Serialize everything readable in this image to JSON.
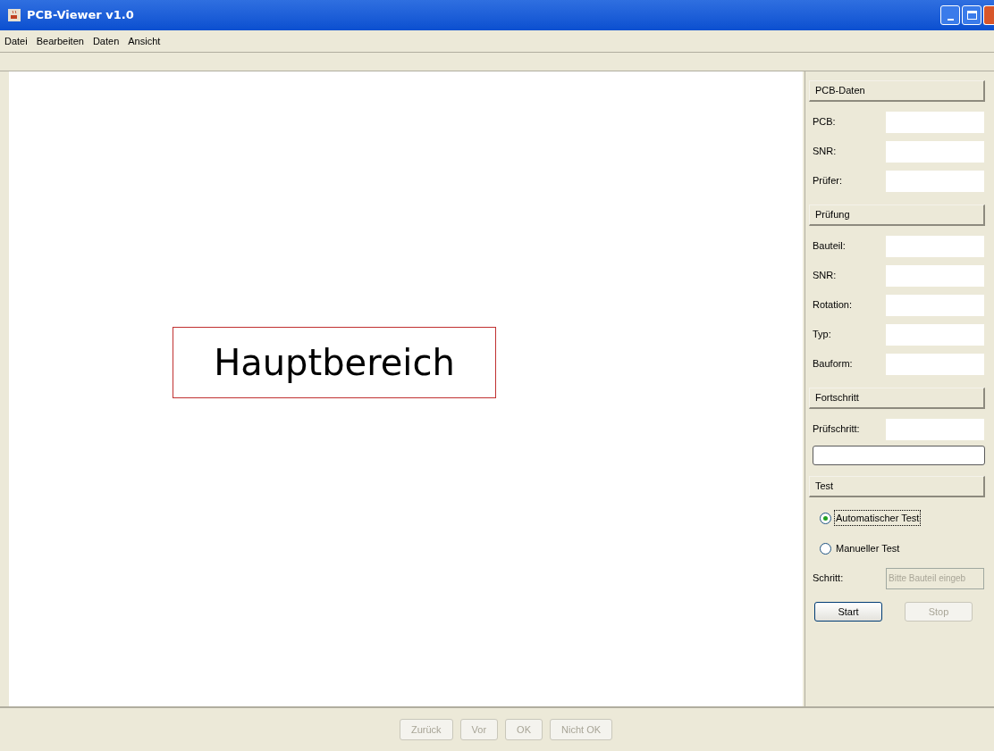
{
  "window": {
    "title": "PCB-Viewer v1.0"
  },
  "menu": [
    "Datei",
    "Bearbeiten",
    "Daten",
    "Ansicht"
  ],
  "main_area": {
    "label": "Hauptbereich"
  },
  "sections": [
    {
      "title": "PCB-Daten",
      "rows": [
        {
          "kind": "field",
          "label": "PCB:"
        },
        {
          "kind": "field",
          "label": "SNR:"
        },
        {
          "kind": "field",
          "label": "Prüfer:"
        }
      ]
    },
    {
      "title": "Prüfung",
      "rows": [
        {
          "kind": "field",
          "label": "Bauteil:"
        },
        {
          "kind": "field",
          "label": "SNR:"
        },
        {
          "kind": "field",
          "label": "Rotation:"
        },
        {
          "kind": "field",
          "label": "Typ:"
        },
        {
          "kind": "field",
          "label": "Bauform:"
        }
      ]
    },
    {
      "title": "Fortschritt",
      "rows": [
        {
          "kind": "field",
          "label": "Prüfschritt:"
        },
        {
          "kind": "progress",
          "level": 0
        }
      ]
    },
    {
      "title": "Test",
      "rows": [
        {
          "kind": "radio",
          "label": "Automatischer Test",
          "selected": true
        },
        {
          "kind": "radio",
          "label": "Manueller Test",
          "selected": false
        },
        {
          "kind": "input",
          "label": "Schritt:",
          "placeholder": "Bitte Bauteil eingeb",
          "disabled": true
        },
        {
          "kind": "buttons",
          "buttons": [
            {
              "label": "Start",
              "disabled": false
            },
            {
              "label": "Stop",
              "disabled": true
            }
          ]
        }
      ]
    }
  ],
  "bottom_buttons": [
    {
      "label": "Zurück",
      "disabled": true
    },
    {
      "label": "Vor",
      "disabled": true
    },
    {
      "label": "OK",
      "disabled": true
    },
    {
      "label": "Nicht OK",
      "disabled": true
    }
  ]
}
